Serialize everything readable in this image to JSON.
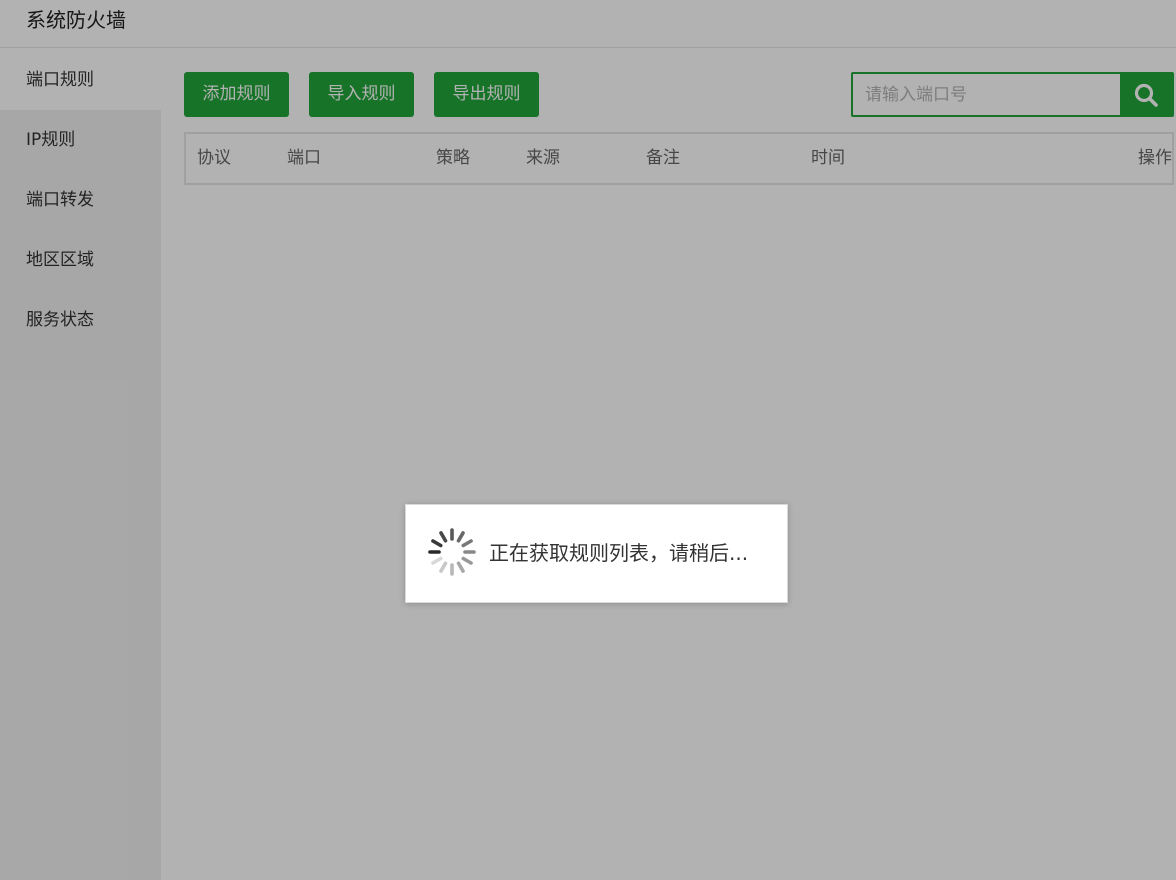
{
  "header": {
    "title": "系统防火墙"
  },
  "sidebar": {
    "items": [
      {
        "label": "端口规则",
        "active": true
      },
      {
        "label": "IP规则",
        "active": false
      },
      {
        "label": "端口转发",
        "active": false
      },
      {
        "label": "地区区域",
        "active": false
      },
      {
        "label": "服务状态",
        "active": false
      }
    ]
  },
  "toolbar": {
    "add_label": "添加规则",
    "import_label": "导入规则",
    "export_label": "导出规则"
  },
  "search": {
    "placeholder": "请输入端口号",
    "value": "",
    "icon": "search-icon"
  },
  "table": {
    "columns": [
      "协议",
      "端口",
      "策略",
      "来源",
      "备注",
      "时间",
      "操作"
    ],
    "rows": []
  },
  "loading": {
    "message": "正在获取规则列表，请稍后...",
    "icon": "spinner-icon"
  },
  "colors": {
    "accent": "#20a53a",
    "overlay": "rgba(0,0,0,0.3)"
  }
}
